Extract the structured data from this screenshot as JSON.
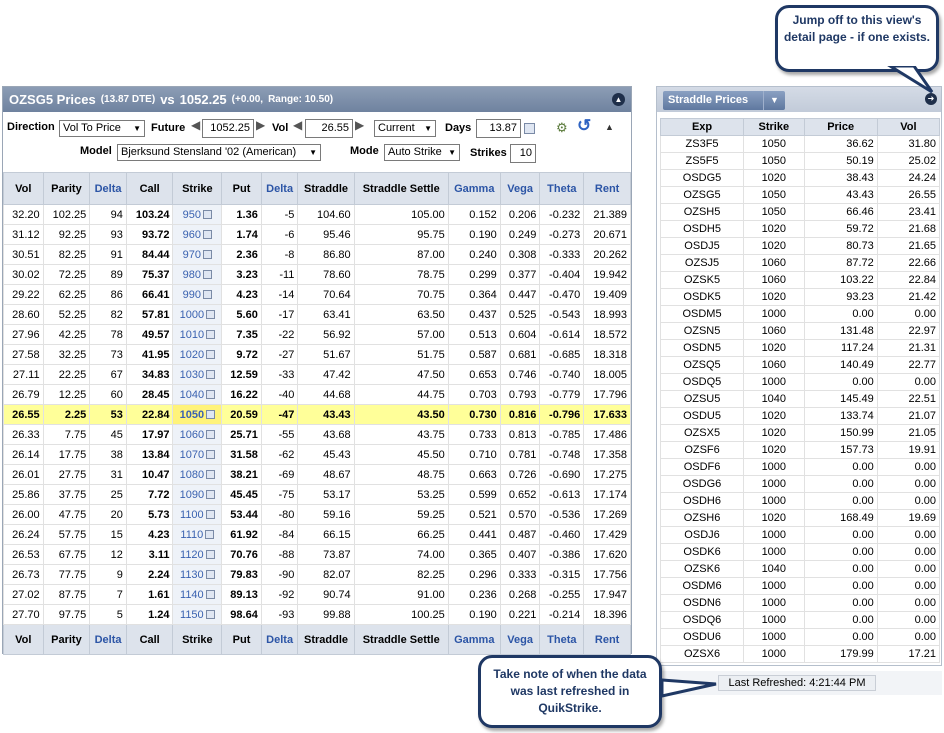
{
  "main": {
    "title": "OZSG5 Prices",
    "dte": "(13.87 DTE)",
    "vs": "vs",
    "price": "1052.25",
    "change": "(+0.00,",
    "range": "Range: 10.50)",
    "collapse_icon": "collapse-icon"
  },
  "controls": {
    "direction_label": "Direction",
    "direction_value": "Vol To Price",
    "future_label": "Future",
    "future_value": "1052.25",
    "vol_label": "Vol",
    "vol_value": "26.55",
    "current_value": "Current",
    "days_label": "Days",
    "days_value": "13.87",
    "model_label": "Model",
    "model_value": "Bjerksund Stensland '02 (American)",
    "mode_label": "Mode",
    "mode_value": "Auto Strike",
    "strikes_label": "Strikes",
    "strikes_value": "10"
  },
  "table": {
    "headers": [
      "Vol",
      "Parity",
      "Delta",
      "Call",
      "Strike",
      "Put",
      "Delta",
      "Straddle",
      "Straddle Settle",
      "Gamma",
      "Vega",
      "Theta",
      "Rent"
    ],
    "highlight_index": 10,
    "rows": [
      [
        "32.20",
        "102.25",
        "94",
        "103.24",
        "950",
        "1.36",
        "-5",
        "104.60",
        "105.00",
        "0.152",
        "0.206",
        "-0.232",
        "21.389"
      ],
      [
        "31.12",
        "92.25",
        "93",
        "93.72",
        "960",
        "1.74",
        "-6",
        "95.46",
        "95.75",
        "0.190",
        "0.249",
        "-0.273",
        "20.671"
      ],
      [
        "30.51",
        "82.25",
        "91",
        "84.44",
        "970",
        "2.36",
        "-8",
        "86.80",
        "87.00",
        "0.240",
        "0.308",
        "-0.333",
        "20.262"
      ],
      [
        "30.02",
        "72.25",
        "89",
        "75.37",
        "980",
        "3.23",
        "-11",
        "78.60",
        "78.75",
        "0.299",
        "0.377",
        "-0.404",
        "19.942"
      ],
      [
        "29.22",
        "62.25",
        "86",
        "66.41",
        "990",
        "4.23",
        "-14",
        "70.64",
        "70.75",
        "0.364",
        "0.447",
        "-0.470",
        "19.409"
      ],
      [
        "28.60",
        "52.25",
        "82",
        "57.81",
        "1000",
        "5.60",
        "-17",
        "63.41",
        "63.50",
        "0.437",
        "0.525",
        "-0.543",
        "18.993"
      ],
      [
        "27.96",
        "42.25",
        "78",
        "49.57",
        "1010",
        "7.35",
        "-22",
        "56.92",
        "57.00",
        "0.513",
        "0.604",
        "-0.614",
        "18.572"
      ],
      [
        "27.58",
        "32.25",
        "73",
        "41.95",
        "1020",
        "9.72",
        "-27",
        "51.67",
        "51.75",
        "0.587",
        "0.681",
        "-0.685",
        "18.318"
      ],
      [
        "27.11",
        "22.25",
        "67",
        "34.83",
        "1030",
        "12.59",
        "-33",
        "47.42",
        "47.50",
        "0.653",
        "0.746",
        "-0.740",
        "18.005"
      ],
      [
        "26.79",
        "12.25",
        "60",
        "28.45",
        "1040",
        "16.22",
        "-40",
        "44.68",
        "44.75",
        "0.703",
        "0.793",
        "-0.779",
        "17.796"
      ],
      [
        "26.55",
        "2.25",
        "53",
        "22.84",
        "1050",
        "20.59",
        "-47",
        "43.43",
        "43.50",
        "0.730",
        "0.816",
        "-0.796",
        "17.633"
      ],
      [
        "26.33",
        "7.75",
        "45",
        "17.97",
        "1060",
        "25.71",
        "-55",
        "43.68",
        "43.75",
        "0.733",
        "0.813",
        "-0.785",
        "17.486"
      ],
      [
        "26.14",
        "17.75",
        "38",
        "13.84",
        "1070",
        "31.58",
        "-62",
        "45.43",
        "45.50",
        "0.710",
        "0.781",
        "-0.748",
        "17.358"
      ],
      [
        "26.01",
        "27.75",
        "31",
        "10.47",
        "1080",
        "38.21",
        "-69",
        "48.67",
        "48.75",
        "0.663",
        "0.726",
        "-0.690",
        "17.275"
      ],
      [
        "25.86",
        "37.75",
        "25",
        "7.72",
        "1090",
        "45.45",
        "-75",
        "53.17",
        "53.25",
        "0.599",
        "0.652",
        "-0.613",
        "17.174"
      ],
      [
        "26.00",
        "47.75",
        "20",
        "5.73",
        "1100",
        "53.44",
        "-80",
        "59.16",
        "59.25",
        "0.521",
        "0.570",
        "-0.536",
        "17.269"
      ],
      [
        "26.24",
        "57.75",
        "15",
        "4.23",
        "1110",
        "61.92",
        "-84",
        "66.15",
        "66.25",
        "0.441",
        "0.487",
        "-0.460",
        "17.429"
      ],
      [
        "26.53",
        "67.75",
        "12",
        "3.11",
        "1120",
        "70.76",
        "-88",
        "73.87",
        "74.00",
        "0.365",
        "0.407",
        "-0.386",
        "17.620"
      ],
      [
        "26.73",
        "77.75",
        "9",
        "2.24",
        "1130",
        "79.83",
        "-90",
        "82.07",
        "82.25",
        "0.296",
        "0.333",
        "-0.315",
        "17.756"
      ],
      [
        "27.02",
        "87.75",
        "7",
        "1.61",
        "1140",
        "89.13",
        "-92",
        "90.74",
        "91.00",
        "0.236",
        "0.268",
        "-0.255",
        "17.947"
      ],
      [
        "27.70",
        "97.75",
        "5",
        "1.24",
        "1150",
        "98.64",
        "-93",
        "99.88",
        "100.25",
        "0.190",
        "0.221",
        "-0.214",
        "18.396"
      ]
    ]
  },
  "straddle": {
    "button_label": "Straddle Prices",
    "headers": [
      "Exp",
      "Strike",
      "Price",
      "Vol"
    ],
    "rows": [
      [
        "ZS3F5",
        "1050",
        "36.62",
        "31.80"
      ],
      [
        "ZS5F5",
        "1050",
        "50.19",
        "25.02"
      ],
      [
        "OSDG5",
        "1020",
        "38.43",
        "24.24"
      ],
      [
        "OZSG5",
        "1050",
        "43.43",
        "26.55"
      ],
      [
        "OZSH5",
        "1050",
        "66.46",
        "23.41"
      ],
      [
        "OSDH5",
        "1020",
        "59.72",
        "21.68"
      ],
      [
        "OSDJ5",
        "1020",
        "80.73",
        "21.65"
      ],
      [
        "OZSJ5",
        "1060",
        "87.72",
        "22.66"
      ],
      [
        "OZSK5",
        "1060",
        "103.22",
        "22.84"
      ],
      [
        "OSDK5",
        "1020",
        "93.23",
        "21.42"
      ],
      [
        "OSDM5",
        "1000",
        "0.00",
        "0.00"
      ],
      [
        "OZSN5",
        "1060",
        "131.48",
        "22.97"
      ],
      [
        "OSDN5",
        "1020",
        "117.24",
        "21.31"
      ],
      [
        "OZSQ5",
        "1060",
        "140.49",
        "22.77"
      ],
      [
        "OSDQ5",
        "1000",
        "0.00",
        "0.00"
      ],
      [
        "OZSU5",
        "1040",
        "145.49",
        "22.51"
      ],
      [
        "OSDU5",
        "1020",
        "133.74",
        "21.07"
      ],
      [
        "OZSX5",
        "1020",
        "150.99",
        "21.05"
      ],
      [
        "OZSF6",
        "1020",
        "157.73",
        "19.91"
      ],
      [
        "OSDF6",
        "1000",
        "0.00",
        "0.00"
      ],
      [
        "OSDG6",
        "1000",
        "0.00",
        "0.00"
      ],
      [
        "OSDH6",
        "1000",
        "0.00",
        "0.00"
      ],
      [
        "OZSH6",
        "1020",
        "168.49",
        "19.69"
      ],
      [
        "OSDJ6",
        "1000",
        "0.00",
        "0.00"
      ],
      [
        "OSDK6",
        "1000",
        "0.00",
        "0.00"
      ],
      [
        "OZSK6",
        "1040",
        "0.00",
        "0.00"
      ],
      [
        "OSDM6",
        "1000",
        "0.00",
        "0.00"
      ],
      [
        "OSDN6",
        "1000",
        "0.00",
        "0.00"
      ],
      [
        "OSDQ6",
        "1000",
        "0.00",
        "0.00"
      ],
      [
        "OSDU6",
        "1000",
        "0.00",
        "0.00"
      ],
      [
        "OZSX6",
        "1000",
        "179.99",
        "17.21"
      ]
    ],
    "last_refreshed": "Last Refreshed: 4:21:44 PM"
  },
  "callouts": {
    "top": "Jump off to this view's detail page - if one exists.",
    "bottom": "Take note of when the data was last refreshed in QuikStrike."
  }
}
